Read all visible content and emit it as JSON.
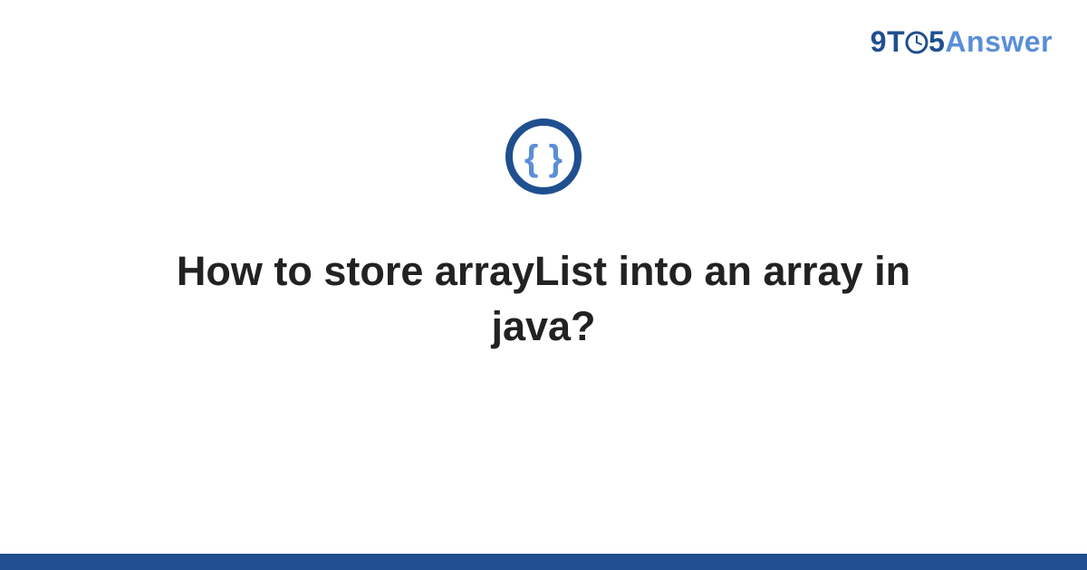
{
  "brand": {
    "nine": "9",
    "t": "T",
    "five": "5",
    "answer": "Answer"
  },
  "category_icon": "code-braces-icon",
  "question": "How to store arrayList into an array in java?",
  "colors": {
    "dark_blue": "#1f4f8f",
    "light_blue": "#5a8fd6"
  }
}
